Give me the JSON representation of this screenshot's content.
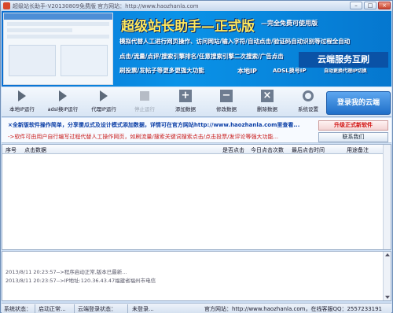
{
  "window": {
    "title": "超级站长助手-V20130809免费版    官方网站：http://www.haozhanla.com",
    "minimize": "–",
    "maximize": "□",
    "close": "×"
  },
  "banner": {
    "title": "超级站长助手—正式版",
    "subtitle": "—完全免费可使用版",
    "line1": "模拟代替人工进行网页操作、访问网站/输入字符/自动点击/验证码自动识别等过程全自动",
    "line2": "点击/流量/点评/搜索引擎排名/任意搜索引擎二次搜索/广告点击",
    "line3": "刷投票/发帖子等更多更强大功能",
    "tags": [
      "本地IP",
      "ADSL换号IP",
      "自动更换代理IP切换"
    ],
    "cloud_label": "云端服务互刷"
  },
  "toolbar": {
    "buttons": [
      {
        "label": "本地IP运行",
        "icon": "play-icon",
        "enabled": true
      },
      {
        "label": "adsl换IP运行",
        "icon": "play-icon",
        "enabled": true
      },
      {
        "label": "代理IP运行",
        "icon": "play-icon",
        "enabled": true
      },
      {
        "label": "停止运行",
        "icon": "stop-icon",
        "enabled": false
      },
      {
        "label": "添加数据",
        "icon": "plus-icon",
        "enabled": true
      },
      {
        "label": "修改数据",
        "icon": "minus-icon",
        "enabled": true
      },
      {
        "label": "删除数据",
        "icon": "delete-icon",
        "enabled": true
      },
      {
        "label": "系统设置",
        "icon": "gear-icon",
        "enabled": true
      }
    ],
    "login_label": "登录我的云端"
  },
  "notice": {
    "line1": "×全新版软件操作简单，分享傻瓜式及设计模式添加数据，详情可在官方网站http://www.haozhanla.com里查看...",
    "line2": "->软件可由用户自行编写过程代替人工操作网页，如刷流量/搜索关键词搜索点击/点击投票/发评论等强大功能...",
    "upgrade_label": "升级正式新软件",
    "contact_label": "联系我们"
  },
  "grid": {
    "columns": [
      "序号",
      "点击数据",
      "是否点击",
      "今日点击次数",
      "最后点击时间",
      "用途备注"
    ]
  },
  "log": {
    "lines": [
      "2013/8/11 20:23:57-->程序启动正常,版本已最新...",
      "2013/8/11 20:23:57-->IP地址:120.36.43.47福建省福州市电信"
    ]
  },
  "status": {
    "system_label": "系统状态：",
    "system_value": "启动正常...",
    "cloud_label": "云端登录状态：",
    "cloud_value": "未登录...",
    "site": "官方网站：http://www.haozhanla.com，在线客服QQ：2557233191"
  }
}
